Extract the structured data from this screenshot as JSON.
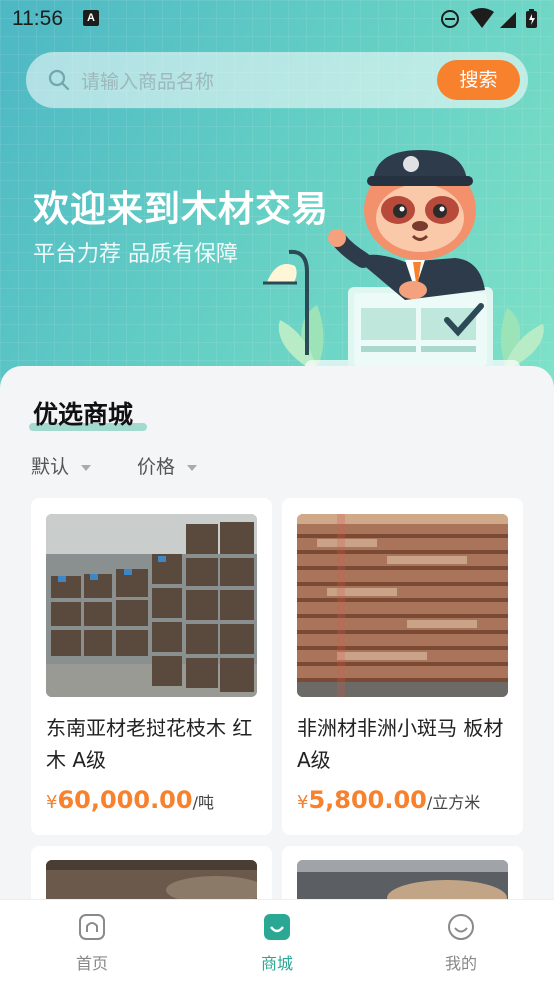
{
  "status": {
    "time": "11:56",
    "notif_badge": "A"
  },
  "search": {
    "placeholder": "请输入商品名称",
    "button": "搜索"
  },
  "hero": {
    "title": "欢迎来到木材交易",
    "subtitle": "平台力荐 品质有保障"
  },
  "section": {
    "title": "优选商城"
  },
  "sort": {
    "default": "默认",
    "price": "价格"
  },
  "products": [
    {
      "name": "东南亚材老挝花枝木 红木 A级",
      "currency": "¥",
      "price": "60,000.00",
      "unit": "/吨"
    },
    {
      "name": "非洲材非洲小斑马 板材 A级",
      "currency": "¥",
      "price": "5,800.00",
      "unit": "/立方米"
    }
  ],
  "tabs": [
    {
      "label": "首页",
      "icon": "home-icon",
      "active": false
    },
    {
      "label": "商城",
      "icon": "mall-icon",
      "active": true
    },
    {
      "label": "我的",
      "icon": "profile-icon",
      "active": false
    }
  ],
  "colors": {
    "accent": "#f7812d",
    "brand": "#2aa894",
    "hero_start": "#4db7c4",
    "hero_end": "#7fe2c8"
  }
}
